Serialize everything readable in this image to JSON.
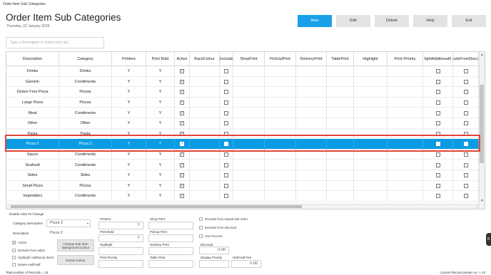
{
  "window_title": "Order Item Sub Categories",
  "page_title": "Order Item Sub Categories",
  "date": "Thursday, 23 January 2025",
  "toolbar": {
    "new": "New",
    "edit": "Edit",
    "delete": "Delete",
    "help": "Help",
    "exit": "Exit"
  },
  "search": {
    "placeholder": "Type a Description or select from list..."
  },
  "grid": {
    "columns": [
      "Description",
      "Category",
      "Printers",
      "Print Bold",
      "Active",
      "BackColour",
      "Exclude",
      "ShopPrint",
      "PickUpPrint",
      "DeliveryPrint",
      "TablePrint",
      "Highlight",
      "Print Priority",
      "lightAdditionalIt",
      "ludeFromDisco"
    ],
    "rows": [
      {
        "desc": "Drinks",
        "cat": "Drinks",
        "printers": "Y",
        "bold": "Y",
        "active": true,
        "exclude": false,
        "highlightAdd": false,
        "excludeDisc": false
      },
      {
        "desc": "Garnish",
        "cat": "Condiments",
        "printers": "Y",
        "bold": "Y",
        "active": true,
        "exclude": false,
        "highlightAdd": false,
        "excludeDisc": false
      },
      {
        "desc": "Gluten Free Pizza",
        "cat": "Pizzas",
        "printers": "Y",
        "bold": "Y",
        "active": true,
        "exclude": false,
        "highlightAdd": false,
        "excludeDisc": false
      },
      {
        "desc": "Large Pizza",
        "cat": "Pizzas",
        "printers": "Y",
        "bold": "Y",
        "active": true,
        "exclude": false,
        "highlightAdd": false,
        "excludeDisc": false
      },
      {
        "desc": "Meat",
        "cat": "Condiments",
        "printers": "Y",
        "bold": "Y",
        "active": true,
        "exclude": false,
        "highlightAdd": false,
        "excludeDisc": false
      },
      {
        "desc": "Other",
        "cat": "Other",
        "printers": "Y",
        "bold": "Y",
        "active": true,
        "exclude": false,
        "highlightAdd": false,
        "excludeDisc": false
      },
      {
        "desc": "Pasta",
        "cat": "Pasta",
        "printers": "Y",
        "bold": "Y",
        "active": true,
        "exclude": false,
        "highlightAdd": false,
        "excludeDisc": false
      },
      {
        "desc": "Pizza 2",
        "cat": "Pizza 2",
        "printers": "Y",
        "bold": "Y",
        "active": true,
        "exclude": false,
        "highlightAdd": false,
        "excludeDisc": false
      },
      {
        "desc": "Sauce",
        "cat": "Condiments",
        "printers": "Y",
        "bold": "Y",
        "active": true,
        "exclude": false,
        "highlightAdd": false,
        "excludeDisc": false
      },
      {
        "desc": "Seafood",
        "cat": "Condiments",
        "printers": "Y",
        "bold": "Y",
        "active": true,
        "exclude": false,
        "highlightAdd": false,
        "excludeDisc": false
      },
      {
        "desc": "Sides",
        "cat": "Sides",
        "printers": "Y",
        "bold": "Y",
        "active": true,
        "exclude": false,
        "highlightAdd": false,
        "excludeDisc": false
      },
      {
        "desc": "Small Pizza",
        "cat": "Pizzas",
        "printers": "Y",
        "bold": "Y",
        "active": true,
        "exclude": false,
        "highlightAdd": false,
        "excludeDisc": false
      },
      {
        "desc": "Vegetables",
        "cat": "Condiments",
        "printers": "Y",
        "bold": "Y",
        "active": true,
        "exclude": false,
        "highlightAdd": false,
        "excludeDisc": false
      }
    ],
    "selected_row": 7
  },
  "detail": {
    "hint": "Double Click To Change",
    "category_description_label": "Category Description",
    "category_description_value": "Pizza 2",
    "description_label": "Description",
    "description_value": "Pizza 2",
    "active_label": "Active",
    "exclude_sales_label": "Exclude from sales",
    "highlight_additional_label": "Highlight Additional Items",
    "delete_half_label": "Delete Half/Half",
    "change_bg_button": "Change Sub Item Background Colour",
    "extras_colour_button": "Extras Colour",
    "printers_label": "Printers",
    "printers_value": "Y",
    "print_bold_label": "Print Bold",
    "print_bold_value": "Y",
    "highlight_label": "Highlight",
    "print_priority_label": "Print Priority",
    "shop_print_label": "Shop Print",
    "pickup_print_label": "Pickup Print",
    "delivery_print_label": "Delivery Print",
    "table_print_label": "Table Print",
    "exclude_repeat_label": "Exclude from repeat last order",
    "exclude_discount_label": "Exclude from discount",
    "use_percent_label": "Use Percent",
    "discount_label": "Discount",
    "discount_value": "0.00",
    "display_priority_label": "Display Priority",
    "half_half_fee_label": "Half Half Fee",
    "half_half_fee_value": "0.00"
  },
  "footer": {
    "total_records": "Total number of Records = 18",
    "current_pointer": "Current Record pointer on -> 13"
  },
  "side_tab": "8",
  "colors": {
    "accent": "#1aa0e8",
    "selected_row": "#0b9be3",
    "highlight_box": "#e0443a"
  }
}
